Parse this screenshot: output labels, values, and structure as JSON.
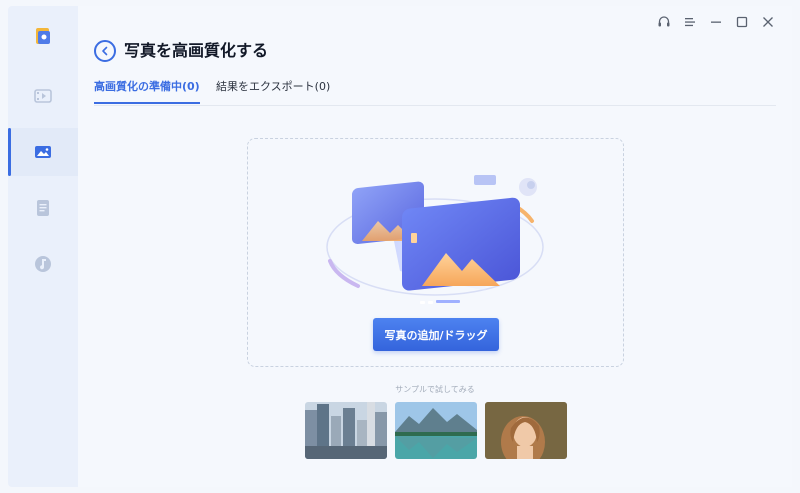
{
  "window": {
    "title": "写真を高画質化する",
    "controls": [
      {
        "name": "headset-icon"
      },
      {
        "name": "menu-icon"
      },
      {
        "name": "minimize-icon"
      },
      {
        "name": "maximize-icon"
      },
      {
        "name": "close-icon"
      }
    ]
  },
  "sidebar": {
    "items": [
      {
        "name": "app-logo-icon",
        "active": false
      },
      {
        "name": "video-icon",
        "active": false
      },
      {
        "name": "photo-icon",
        "active": true
      },
      {
        "name": "document-icon",
        "active": false
      },
      {
        "name": "music-icon",
        "active": false
      }
    ]
  },
  "tabs": [
    {
      "label": "高画質化の準備中(0)",
      "active": true
    },
    {
      "label": "結果をエクスポート(0)",
      "active": false
    }
  ],
  "dropzone": {
    "add_button_label": "写真の追加/ドラッグ"
  },
  "samples": {
    "label": "サンプルで試してみる",
    "items": [
      {
        "name": "sample-city"
      },
      {
        "name": "sample-lake"
      },
      {
        "name": "sample-portrait"
      }
    ]
  },
  "colors": {
    "accent": "#3b6de2",
    "sidebar_bg": "#eaf0fb",
    "main_bg": "#f5f8fd"
  }
}
